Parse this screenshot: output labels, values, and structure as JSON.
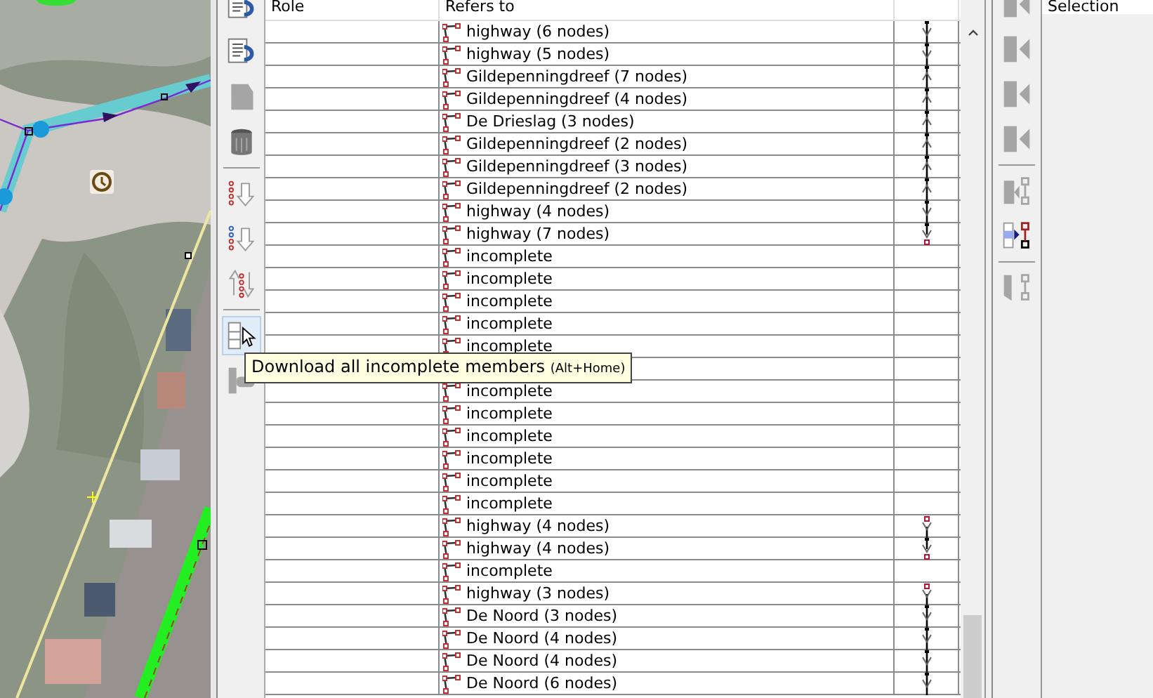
{
  "left_toolbar": [
    {
      "kind": "list-up",
      "disabled": false,
      "hovered": false
    },
    {
      "kind": "list-down",
      "disabled": false,
      "hovered": false
    },
    {
      "kind": "edit",
      "disabled": true,
      "hovered": false
    },
    {
      "kind": "delete",
      "disabled": false,
      "hovered": false
    },
    {
      "kind": "sort",
      "disabled": false,
      "hovered": false
    },
    {
      "kind": "sort-alt",
      "disabled": false,
      "hovered": false
    },
    {
      "kind": "reverse",
      "disabled": false,
      "hovered": false
    },
    {
      "kind": "download",
      "disabled": false,
      "hovered": true
    },
    {
      "kind": "select",
      "disabled": true,
      "hovered": false
    }
  ],
  "table": {
    "columns": [
      "Role",
      "Refers to"
    ],
    "rows": [
      {
        "refers_to": "highway (6 nodes)",
        "link": {
          "backward": false,
          "start": false,
          "end": false
        }
      },
      {
        "refers_to": "highway (5 nodes)",
        "link": {
          "backward": false,
          "start": false,
          "end": false
        }
      },
      {
        "refers_to": "Gildepenningdreef (7 nodes)",
        "link": {
          "backward": true,
          "start": false,
          "end": false
        }
      },
      {
        "refers_to": "Gildepenningdreef (4 nodes)",
        "link": {
          "backward": true,
          "start": false,
          "end": false
        }
      },
      {
        "refers_to": "De Drieslag (3 nodes)",
        "link": {
          "backward": true,
          "start": false,
          "end": false
        }
      },
      {
        "refers_to": "Gildepenningdreef (2 nodes)",
        "link": {
          "backward": true,
          "start": false,
          "end": false
        }
      },
      {
        "refers_to": "Gildepenningdreef (3 nodes)",
        "link": {
          "backward": true,
          "start": false,
          "end": false
        }
      },
      {
        "refers_to": "Gildepenningdreef (2 nodes)",
        "link": {
          "backward": true,
          "start": false,
          "end": false
        }
      },
      {
        "refers_to": "highway (4 nodes)",
        "link": {
          "backward": false,
          "start": false,
          "end": false
        }
      },
      {
        "refers_to": "highway (7 nodes)",
        "link": {
          "backward": false,
          "start": false,
          "end": true
        }
      },
      {
        "refers_to": "incomplete"
      },
      {
        "refers_to": "incomplete"
      },
      {
        "refers_to": "incomplete"
      },
      {
        "refers_to": "incomplete"
      },
      {
        "refers_to": "incomplete"
      },
      {},
      {
        "refers_to": "incomplete"
      },
      {
        "refers_to": "incomplete"
      },
      {
        "refers_to": "incomplete"
      },
      {
        "refers_to": "incomplete"
      },
      {
        "refers_to": "incomplete"
      },
      {
        "refers_to": "incomplete"
      },
      {
        "refers_to": "highway (4 nodes)",
        "link": {
          "backward": false,
          "start": true,
          "end": false
        }
      },
      {
        "refers_to": "highway (4 nodes)",
        "link": {
          "backward": false,
          "start": false,
          "end": true
        }
      },
      {
        "refers_to": "incomplete"
      },
      {
        "refers_to": "highway (3 nodes)",
        "link": {
          "backward": false,
          "start": true,
          "end": false
        }
      },
      {
        "refers_to": "De Noord (3 nodes)",
        "link": {
          "backward": false,
          "start": false,
          "end": false
        }
      },
      {
        "refers_to": "De Noord (4 nodes)",
        "link": {
          "backward": false,
          "start": false,
          "end": false
        }
      },
      {
        "refers_to": "De Noord (4 nodes)",
        "link": {
          "backward": false,
          "start": false,
          "end": false
        }
      },
      {
        "refers_to": "De Noord (6 nodes)",
        "link": {
          "backward": false,
          "start": false,
          "end": false
        }
      }
    ]
  },
  "tooltip": {
    "text": "Download all incomplete members",
    "shortcut": "(Alt+Home)"
  },
  "right_toolbar": [
    {
      "kind": "add-top",
      "disabled": true
    },
    {
      "kind": "add-before",
      "disabled": true
    },
    {
      "kind": "add-after",
      "disabled": true
    },
    {
      "kind": "add-bottom",
      "disabled": true
    },
    {
      "kind": "select-members",
      "disabled": true
    },
    {
      "kind": "select-in-table",
      "disabled": false
    },
    {
      "kind": "remove-selected",
      "disabled": true
    }
  ],
  "selection_panel": {
    "title": "Selection"
  }
}
